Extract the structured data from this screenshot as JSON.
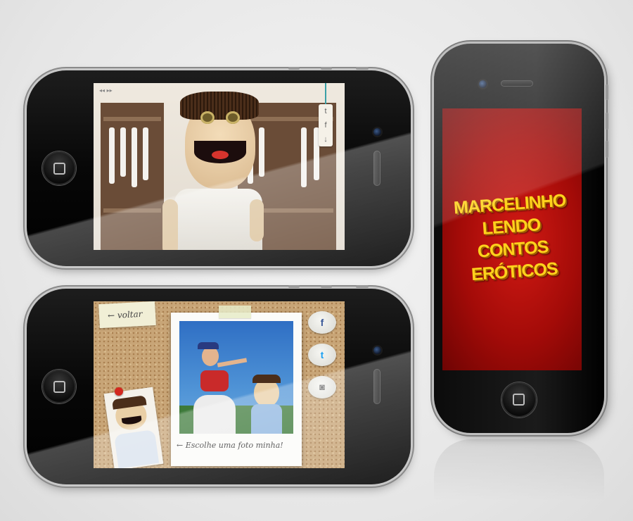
{
  "phone_top": {
    "tags": {
      "twitter_glyph": "t",
      "facebook_glyph": "f",
      "download_glyph": "↓"
    },
    "nav_glyph": "◂◂ ▸▸"
  },
  "phone_bottom": {
    "back_label": "← voltar",
    "caption": "← Escolhe uma foto minha!",
    "bubbles": {
      "facebook_glyph": "f",
      "twitter_glyph": "t",
      "instagram_glyph": "◙"
    }
  },
  "phone_right": {
    "title_line1": "MARCELINHO LENDO",
    "title_line2": "CONTOS ERÓTICOS"
  },
  "colors": {
    "title": "#ffd21c",
    "screen_red": "#c4130f",
    "facebook": "#3b5998",
    "twitter": "#1da1f2"
  }
}
